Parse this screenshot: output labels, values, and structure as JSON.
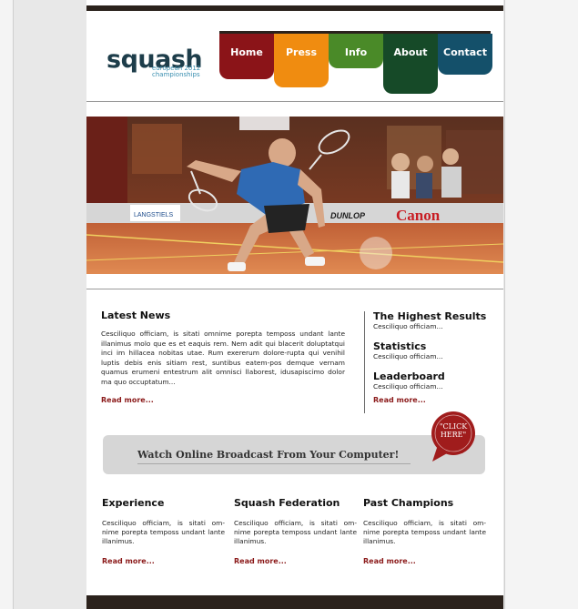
{
  "logo": {
    "main": "squash",
    "sub_line1": "european 2012",
    "sub_line2": "championships"
  },
  "nav": [
    {
      "label": "Home",
      "color": "#8b1418"
    },
    {
      "label": "Press",
      "color": "#f08c10"
    },
    {
      "label": "Info",
      "color": "#4a8a28"
    },
    {
      "label": "About",
      "color": "#164a28"
    },
    {
      "label": "Contact",
      "color": "#14506a"
    }
  ],
  "hero": {
    "banner_brand": "Canon",
    "banner_dunlop": "DUNLOP",
    "banner_left": "LANGSTIELS"
  },
  "news": {
    "title": "Latest News",
    "body": "Cesciliquo officiam, is sitati omnime porepta temposs undant lante illanimus molo que es et eaquis rem. Nem adit qui blacerit doluptatqui inci im hillacea nobitas utae. Rum exererum dolore-rupta qui venihil luptis debis enis sitiam rest, suntibus eatem-pos demque vernam quamus erumeni entestrum alit omnisci llaborest, idusapiscimo dolor ma quo occuptatum...",
    "read_more": "Read more..."
  },
  "sidebar": [
    {
      "title": "The Highest Results",
      "sub": "Cesciliquo officiam..."
    },
    {
      "title": "Statistics",
      "sub": "Cesciliquo officiam..."
    },
    {
      "title": "Leaderboard",
      "sub": "Cesciliquo officiam..."
    }
  ],
  "sidebar_read_more": "Read more...",
  "broadcast": {
    "text": "Watch Online Broadcast From Your Computer!",
    "click_line1": "\"CLICK",
    "click_line2": "HERE\""
  },
  "columns": [
    {
      "title": "Experience",
      "body": "Cesciliquo officiam, is sitati om-nime porepta temposs undant lante illanimus.",
      "read_more": "Read more..."
    },
    {
      "title": "Squash Federation",
      "body": "Cesciliquo officiam, is sitati om-nime porepta temposs undant lante illanimus.",
      "read_more": "Read more..."
    },
    {
      "title": "Past Champions",
      "body": "Cesciliquo officiam, is sitati om-nime porepta temposs undant lante illanimus.",
      "read_more": "Read more..."
    }
  ],
  "colors": {
    "accent": "#8b1a1a",
    "dark": "#2b221c",
    "logo": "#1d3d4a"
  }
}
